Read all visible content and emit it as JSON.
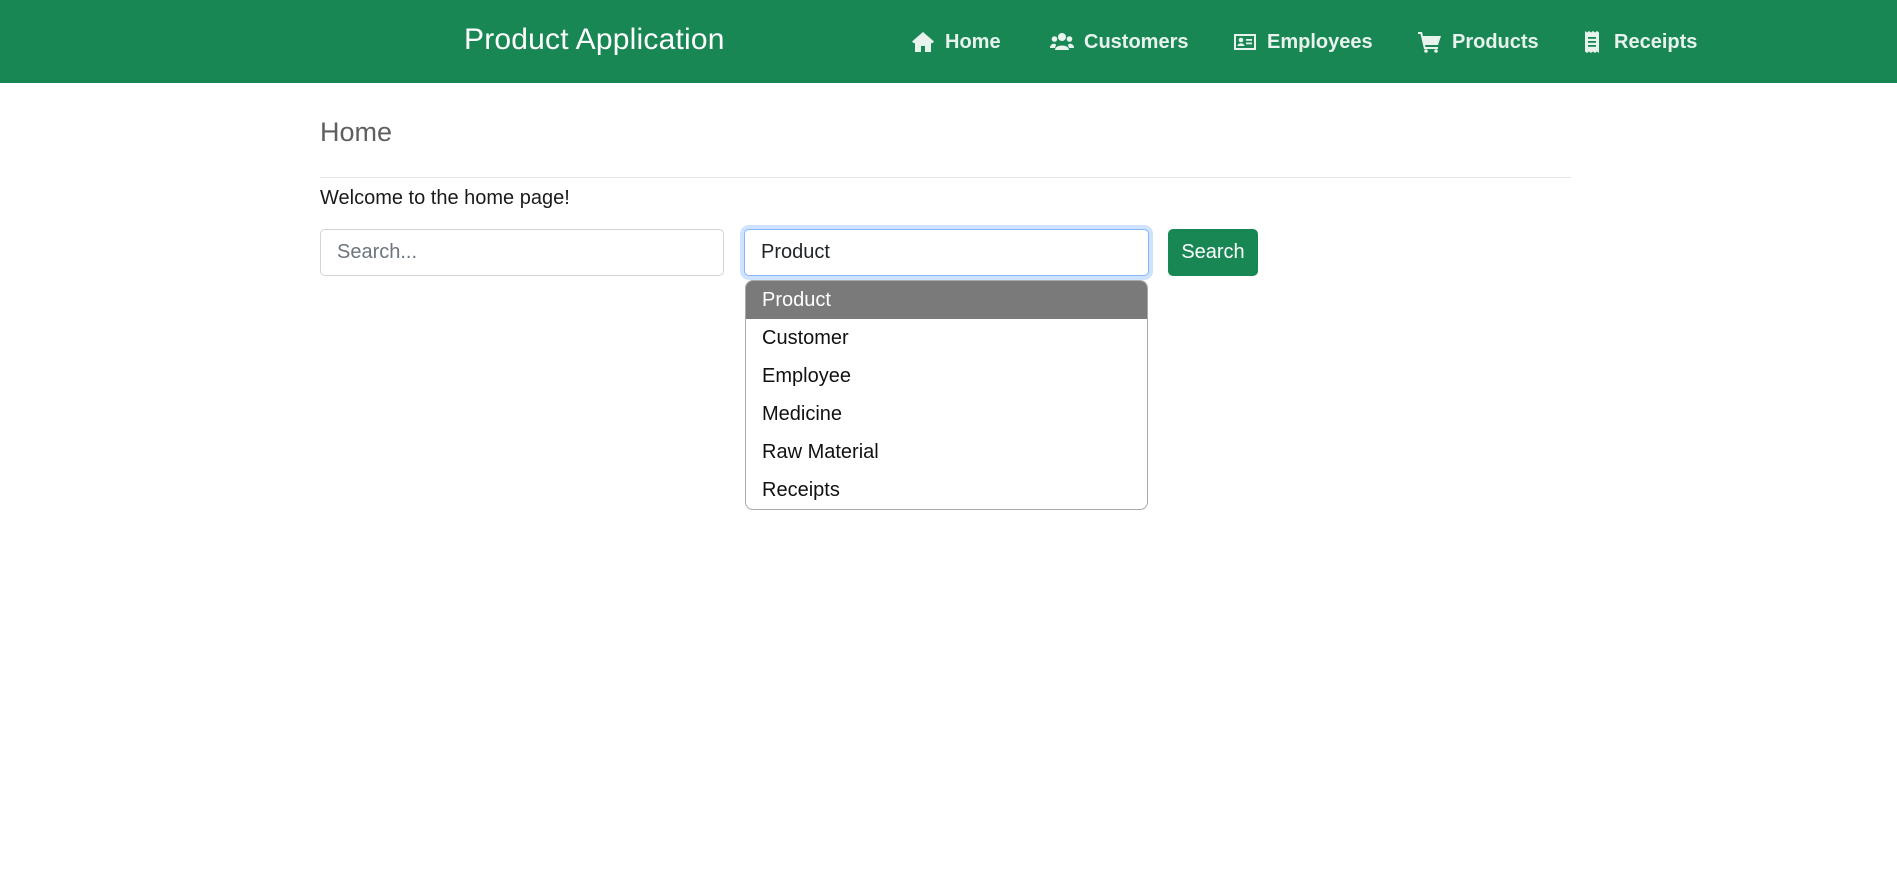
{
  "app": {
    "brand": "Product Application"
  },
  "nav": {
    "items": [
      {
        "label": "Home",
        "icon": "home-icon"
      },
      {
        "label": "Customers",
        "icon": "users-icon"
      },
      {
        "label": "Employees",
        "icon": "id-card-icon"
      },
      {
        "label": "Products",
        "icon": "cart-icon"
      },
      {
        "label": "Receipts",
        "icon": "receipt-icon"
      }
    ]
  },
  "main": {
    "title": "Home",
    "welcome": "Welcome to the home page!"
  },
  "search": {
    "placeholder": "Search...",
    "value": "",
    "category_selected": "Product",
    "button_label": "Search",
    "options": [
      "Product",
      "Customer",
      "Employee",
      "Medicine",
      "Raw Material",
      "Receipts"
    ]
  },
  "colors": {
    "navbar": "#198754",
    "button": "#198754",
    "selected_option": "#7a7a7a",
    "focus_border": "#86b7fe"
  }
}
